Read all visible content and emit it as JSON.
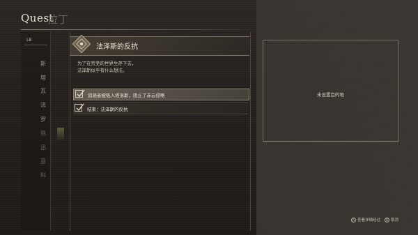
{
  "header": {
    "title": "Quest",
    "ghost_tab": "拉丁"
  },
  "leftnav": {
    "bumper_label": "LB",
    "items": [
      {
        "label": "斯"
      },
      {
        "label": "塔"
      },
      {
        "label": "瓦"
      },
      {
        "label": "法"
      },
      {
        "label": "罗"
      },
      {
        "label": "熟"
      },
      {
        "label": "迅"
      },
      {
        "label": "意"
      },
      {
        "label": "科"
      }
    ]
  },
  "quest": {
    "title": "法泽斯的反抗",
    "icon": "quest-seal-icon",
    "description_line1": "为了在荒芜的世界生存下去，",
    "description_line2": "法泽斯似乎有什么想法。",
    "steps": [
      {
        "text": "追随者被吸入塔洛斯，阻止了赤云侵略",
        "state": "active"
      },
      {
        "text": "结束：法泽斯的反抗",
        "state": "done"
      }
    ]
  },
  "map_panel": {
    "label": "未设置目的地"
  },
  "hints": {
    "details_button": "A",
    "details_label": "查看详细经过",
    "cancel_button": "B",
    "cancel_label": "取消"
  },
  "colors": {
    "accent": "#cfc7b4",
    "panel": "#3d3833"
  }
}
